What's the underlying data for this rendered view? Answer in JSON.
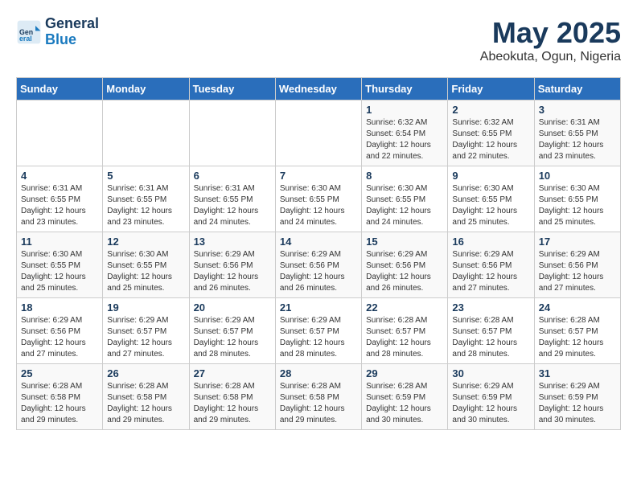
{
  "logo": {
    "line1": "General",
    "line2": "Blue"
  },
  "title": "May 2025",
  "subtitle": "Abeokuta, Ogun, Nigeria",
  "days_of_week": [
    "Sunday",
    "Monday",
    "Tuesday",
    "Wednesday",
    "Thursday",
    "Friday",
    "Saturday"
  ],
  "weeks": [
    [
      {
        "day": "",
        "info": ""
      },
      {
        "day": "",
        "info": ""
      },
      {
        "day": "",
        "info": ""
      },
      {
        "day": "",
        "info": ""
      },
      {
        "day": "1",
        "info": "Sunrise: 6:32 AM\nSunset: 6:54 PM\nDaylight: 12 hours\nand 22 minutes."
      },
      {
        "day": "2",
        "info": "Sunrise: 6:32 AM\nSunset: 6:55 PM\nDaylight: 12 hours\nand 22 minutes."
      },
      {
        "day": "3",
        "info": "Sunrise: 6:31 AM\nSunset: 6:55 PM\nDaylight: 12 hours\nand 23 minutes."
      }
    ],
    [
      {
        "day": "4",
        "info": "Sunrise: 6:31 AM\nSunset: 6:55 PM\nDaylight: 12 hours\nand 23 minutes."
      },
      {
        "day": "5",
        "info": "Sunrise: 6:31 AM\nSunset: 6:55 PM\nDaylight: 12 hours\nand 23 minutes."
      },
      {
        "day": "6",
        "info": "Sunrise: 6:31 AM\nSunset: 6:55 PM\nDaylight: 12 hours\nand 24 minutes."
      },
      {
        "day": "7",
        "info": "Sunrise: 6:30 AM\nSunset: 6:55 PM\nDaylight: 12 hours\nand 24 minutes."
      },
      {
        "day": "8",
        "info": "Sunrise: 6:30 AM\nSunset: 6:55 PM\nDaylight: 12 hours\nand 24 minutes."
      },
      {
        "day": "9",
        "info": "Sunrise: 6:30 AM\nSunset: 6:55 PM\nDaylight: 12 hours\nand 25 minutes."
      },
      {
        "day": "10",
        "info": "Sunrise: 6:30 AM\nSunset: 6:55 PM\nDaylight: 12 hours\nand 25 minutes."
      }
    ],
    [
      {
        "day": "11",
        "info": "Sunrise: 6:30 AM\nSunset: 6:55 PM\nDaylight: 12 hours\nand 25 minutes."
      },
      {
        "day": "12",
        "info": "Sunrise: 6:30 AM\nSunset: 6:55 PM\nDaylight: 12 hours\nand 25 minutes."
      },
      {
        "day": "13",
        "info": "Sunrise: 6:29 AM\nSunset: 6:56 PM\nDaylight: 12 hours\nand 26 minutes."
      },
      {
        "day": "14",
        "info": "Sunrise: 6:29 AM\nSunset: 6:56 PM\nDaylight: 12 hours\nand 26 minutes."
      },
      {
        "day": "15",
        "info": "Sunrise: 6:29 AM\nSunset: 6:56 PM\nDaylight: 12 hours\nand 26 minutes."
      },
      {
        "day": "16",
        "info": "Sunrise: 6:29 AM\nSunset: 6:56 PM\nDaylight: 12 hours\nand 27 minutes."
      },
      {
        "day": "17",
        "info": "Sunrise: 6:29 AM\nSunset: 6:56 PM\nDaylight: 12 hours\nand 27 minutes."
      }
    ],
    [
      {
        "day": "18",
        "info": "Sunrise: 6:29 AM\nSunset: 6:56 PM\nDaylight: 12 hours\nand 27 minutes."
      },
      {
        "day": "19",
        "info": "Sunrise: 6:29 AM\nSunset: 6:57 PM\nDaylight: 12 hours\nand 27 minutes."
      },
      {
        "day": "20",
        "info": "Sunrise: 6:29 AM\nSunset: 6:57 PM\nDaylight: 12 hours\nand 28 minutes."
      },
      {
        "day": "21",
        "info": "Sunrise: 6:29 AM\nSunset: 6:57 PM\nDaylight: 12 hours\nand 28 minutes."
      },
      {
        "day": "22",
        "info": "Sunrise: 6:28 AM\nSunset: 6:57 PM\nDaylight: 12 hours\nand 28 minutes."
      },
      {
        "day": "23",
        "info": "Sunrise: 6:28 AM\nSunset: 6:57 PM\nDaylight: 12 hours\nand 28 minutes."
      },
      {
        "day": "24",
        "info": "Sunrise: 6:28 AM\nSunset: 6:57 PM\nDaylight: 12 hours\nand 29 minutes."
      }
    ],
    [
      {
        "day": "25",
        "info": "Sunrise: 6:28 AM\nSunset: 6:58 PM\nDaylight: 12 hours\nand 29 minutes."
      },
      {
        "day": "26",
        "info": "Sunrise: 6:28 AM\nSunset: 6:58 PM\nDaylight: 12 hours\nand 29 minutes."
      },
      {
        "day": "27",
        "info": "Sunrise: 6:28 AM\nSunset: 6:58 PM\nDaylight: 12 hours\nand 29 minutes."
      },
      {
        "day": "28",
        "info": "Sunrise: 6:28 AM\nSunset: 6:58 PM\nDaylight: 12 hours\nand 29 minutes."
      },
      {
        "day": "29",
        "info": "Sunrise: 6:28 AM\nSunset: 6:59 PM\nDaylight: 12 hours\nand 30 minutes."
      },
      {
        "day": "30",
        "info": "Sunrise: 6:29 AM\nSunset: 6:59 PM\nDaylight: 12 hours\nand 30 minutes."
      },
      {
        "day": "31",
        "info": "Sunrise: 6:29 AM\nSunset: 6:59 PM\nDaylight: 12 hours\nand 30 minutes."
      }
    ]
  ]
}
